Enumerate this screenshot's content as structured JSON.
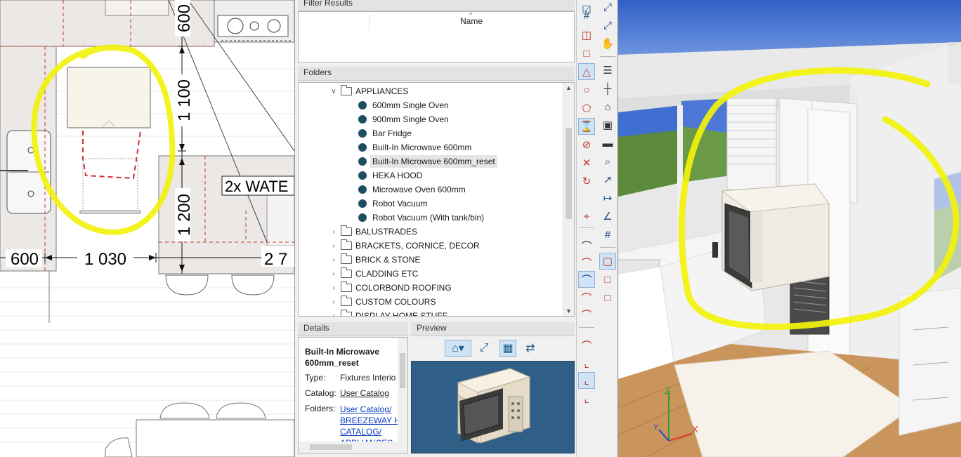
{
  "plan": {
    "dimensions": [
      "600",
      "1 100",
      "1 200",
      "600",
      "1 030",
      "2 7"
    ],
    "label": "2x WATE"
  },
  "browser": {
    "filter_results_title": "Filter Results",
    "name_column": "Name",
    "folders_title": "Folders",
    "tree": {
      "open_folder": "APPLIANCES",
      "items": [
        "600mm Single Oven",
        " 900mm Single Oven",
        "Bar Fridge",
        "Built-In Microwave 600mm",
        "Built-In Microwave 600mm_reset",
        "HEKA HOOD",
        "Microwave Oven 600mm",
        "Robot Vacuum",
        "Robot Vacuum (With tank/bin)"
      ],
      "folders": [
        "BALUSTRADES",
        "BRACKETS, CORNICE, DECOR",
        "BRICK & STONE",
        "CLADDING ETC",
        "COLORBOND ROOFING",
        "CUSTOM COLOURS",
        "DISPLAY HOME STUFF"
      ]
    },
    "details": {
      "title": "Details",
      "item_name": "Built-In Microwave 600mm_reset",
      "type_label": "Type:",
      "type_value": "Fixtures Interio",
      "catalog_label": "Catalog:",
      "catalog_value": "User Catalog",
      "folders_label": "Folders:",
      "folders_value_1": "User Catalog/",
      "folders_value_2": "BREEZEWAY HO",
      "folders_value_3": "CATALOG/",
      "folders_value_4": "APPLIANCES"
    },
    "preview": {
      "title": "Preview"
    }
  },
  "view3d": {
    "axes": {
      "x": "X",
      "y": "Y",
      "z": "Z"
    }
  },
  "colors": {
    "highlight_yellow": "#f2f20a",
    "selection_bg": "#e5e5e5",
    "tree_dot": "#1f4e63",
    "link": "#0a3cc2",
    "preview_bg": "#2f5f86",
    "sky": "#3f6fd0",
    "grass": "#5c8a3a",
    "floor": "#c9955c"
  }
}
